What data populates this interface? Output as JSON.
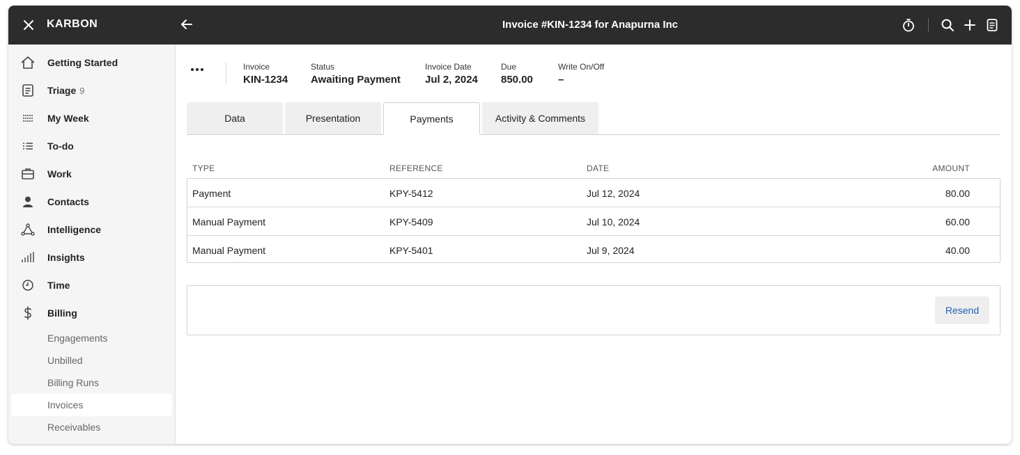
{
  "app": {
    "brand": "KARBON",
    "title": "Invoice #KIN-1234 for Anapurna Inc"
  },
  "topbar": {
    "icons": [
      "close-icon",
      "back-arrow-icon",
      "timer-icon",
      "search-icon",
      "plus-icon",
      "notes-icon"
    ]
  },
  "sidebar": {
    "items": [
      {
        "label": "Getting Started",
        "icon": "home-icon"
      },
      {
        "label": "Triage",
        "count": "9",
        "icon": "triage-icon"
      },
      {
        "label": "My Week",
        "icon": "my-week-icon"
      },
      {
        "label": "To-do",
        "icon": "todo-list-icon"
      },
      {
        "label": "Work",
        "icon": "briefcase-icon"
      },
      {
        "label": "Contacts",
        "icon": "person-icon"
      },
      {
        "label": "Intelligence",
        "icon": "network-icon"
      },
      {
        "label": "Insights",
        "icon": "bar-chart-icon"
      },
      {
        "label": "Time",
        "icon": "clock-icon"
      },
      {
        "label": "Billing",
        "icon": "dollar-icon"
      }
    ],
    "billing_sub": [
      {
        "label": "Engagements"
      },
      {
        "label": "Unbilled"
      },
      {
        "label": "Billing Runs"
      },
      {
        "label": "Invoices",
        "active": true
      },
      {
        "label": "Receivables"
      }
    ]
  },
  "invoice": {
    "fields": [
      {
        "label": "Invoice",
        "value": "KIN-1234"
      },
      {
        "label": "Status",
        "value": "Awaiting Payment"
      },
      {
        "label": "Invoice Date",
        "value": "Jul 2, 2024"
      },
      {
        "label": "Due",
        "value": "850.00"
      },
      {
        "label": "Write On/Off",
        "value": "–"
      }
    ]
  },
  "tabs": [
    {
      "label": "Data"
    },
    {
      "label": "Presentation"
    },
    {
      "label": "Payments",
      "active": true
    },
    {
      "label": "Activity & Comments"
    }
  ],
  "payments": {
    "columns": [
      "TYPE",
      "REFERENCE",
      "DATE",
      "AMOUNT"
    ],
    "rows": [
      {
        "type": "Payment",
        "reference": "KPY-5412",
        "date": "Jul 12, 2024",
        "amount": "80.00"
      },
      {
        "type": "Manual Payment",
        "reference": "KPY-5409",
        "date": "Jul 10, 2024",
        "amount": "60.00"
      },
      {
        "type": "Manual Payment",
        "reference": "KPY-5401",
        "date": "Jul 9, 2024",
        "amount": "40.00"
      }
    ]
  },
  "actions": {
    "resend_label": "Resend"
  },
  "colors": {
    "topbar": "#2c2c2c",
    "sidebar": "#f5f5f5",
    "link": "#1f63b5"
  }
}
